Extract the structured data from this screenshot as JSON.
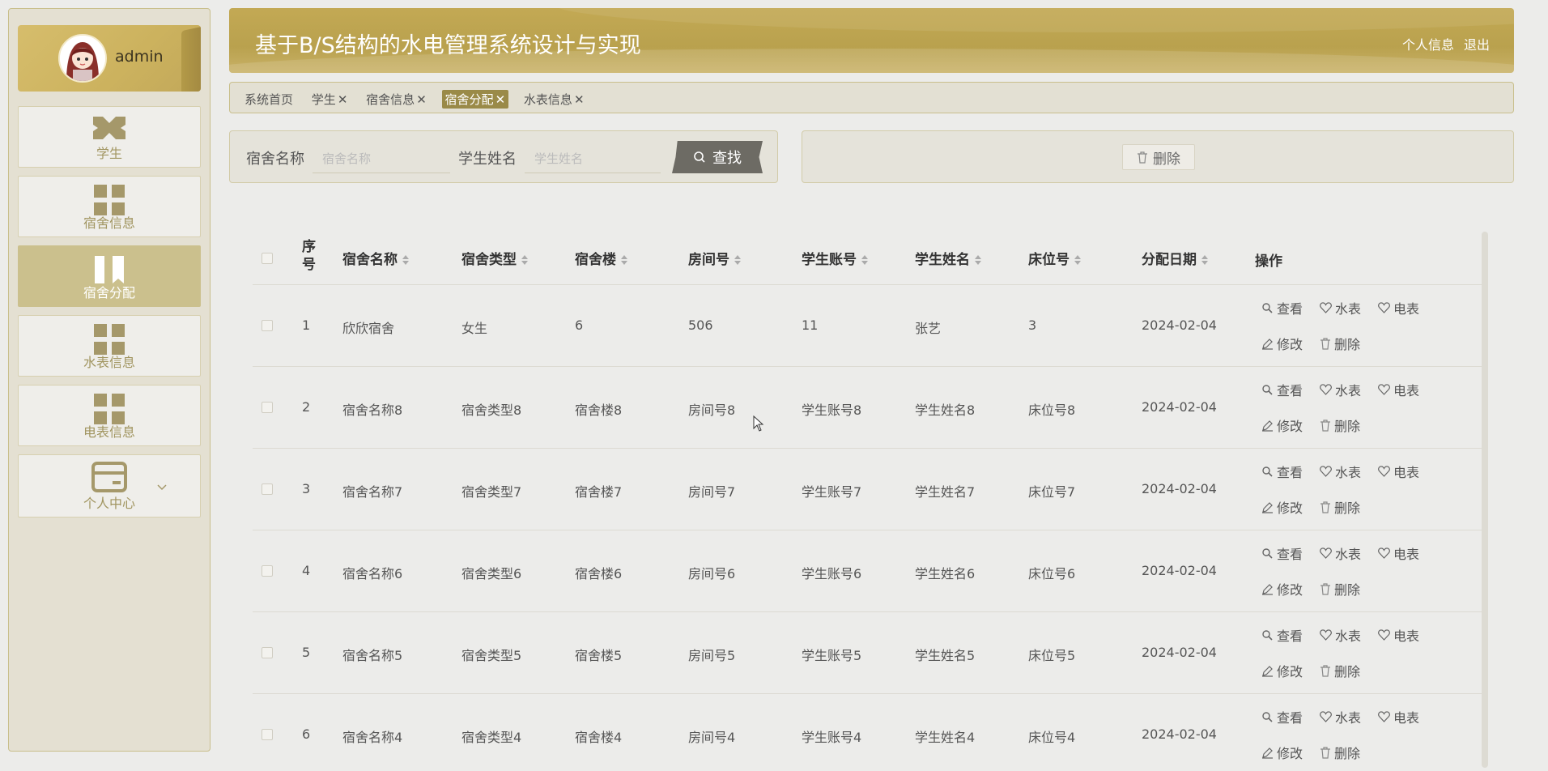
{
  "user": {
    "name": "admin"
  },
  "sidebar": {
    "items": [
      {
        "label": "学生",
        "icon": "ticket-icon"
      },
      {
        "label": "宿舍信息",
        "icon": "grid-icon"
      },
      {
        "label": "宿舍分配",
        "icon": "book-icon"
      },
      {
        "label": "水表信息",
        "icon": "grid-icon"
      },
      {
        "label": "电表信息",
        "icon": "grid-icon"
      },
      {
        "label": "个人中心",
        "icon": "card-icon"
      }
    ]
  },
  "header": {
    "title": "基于B/S结构的水电管理系统设计与实现",
    "profile_link": "个人信息",
    "logout_link": "退出"
  },
  "tabs": [
    {
      "label": "系统首页",
      "closable": false
    },
    {
      "label": "学生",
      "closable": true
    },
    {
      "label": "宿舍信息",
      "closable": true
    },
    {
      "label": "宿舍分配",
      "closable": true,
      "active": true
    },
    {
      "label": "水表信息",
      "closable": true
    }
  ],
  "search": {
    "dorm_label": "宿舍名称",
    "dorm_placeholder": "宿舍名称",
    "student_label": "学生姓名",
    "student_placeholder": "学生姓名",
    "button": "查找"
  },
  "actions": {
    "delete": "删除"
  },
  "table": {
    "columns": {
      "index": "序号",
      "dorm_name": "宿舍名称",
      "dorm_type": "宿舍类型",
      "building": "宿舍楼",
      "room": "房间号",
      "account": "学生账号",
      "student": "学生姓名",
      "bed": "床位号",
      "date": "分配日期",
      "ops": "操作"
    },
    "ops": {
      "view": "查看",
      "water": "水表",
      "electric": "电表",
      "edit": "修改",
      "delete": "删除"
    },
    "rows": [
      {
        "index": "1",
        "dorm_name": "欣欣宿舍",
        "dorm_type": "女生",
        "building": "6",
        "room": "506",
        "account": "11",
        "student": "张艺",
        "bed": "3",
        "date": "2024-02-04"
      },
      {
        "index": "2",
        "dorm_name": "宿舍名称8",
        "dorm_type": "宿舍类型8",
        "building": "宿舍楼8",
        "room": "房间号8",
        "account": "学生账号8",
        "student": "学生姓名8",
        "bed": "床位号8",
        "date": "2024-02-04"
      },
      {
        "index": "3",
        "dorm_name": "宿舍名称7",
        "dorm_type": "宿舍类型7",
        "building": "宿舍楼7",
        "room": "房间号7",
        "account": "学生账号7",
        "student": "学生姓名7",
        "bed": "床位号7",
        "date": "2024-02-04"
      },
      {
        "index": "4",
        "dorm_name": "宿舍名称6",
        "dorm_type": "宿舍类型6",
        "building": "宿舍楼6",
        "room": "房间号6",
        "account": "学生账号6",
        "student": "学生姓名6",
        "bed": "床位号6",
        "date": "2024-02-04"
      },
      {
        "index": "5",
        "dorm_name": "宿舍名称5",
        "dorm_type": "宿舍类型5",
        "building": "宿舍楼5",
        "room": "房间号5",
        "account": "学生账号5",
        "student": "学生姓名5",
        "bed": "床位号5",
        "date": "2024-02-04"
      },
      {
        "index": "6",
        "dorm_name": "宿舍名称4",
        "dorm_type": "宿舍类型4",
        "building": "宿舍楼4",
        "room": "房间号4",
        "account": "学生账号4",
        "student": "学生姓名4",
        "bed": "床位号4",
        "date": "2024-02-04"
      }
    ]
  },
  "colors": {
    "accent": "#c3a954",
    "active_menu": "#cbc08d",
    "active_tab": "#9a8a48",
    "search_button": "#6d6b64"
  }
}
